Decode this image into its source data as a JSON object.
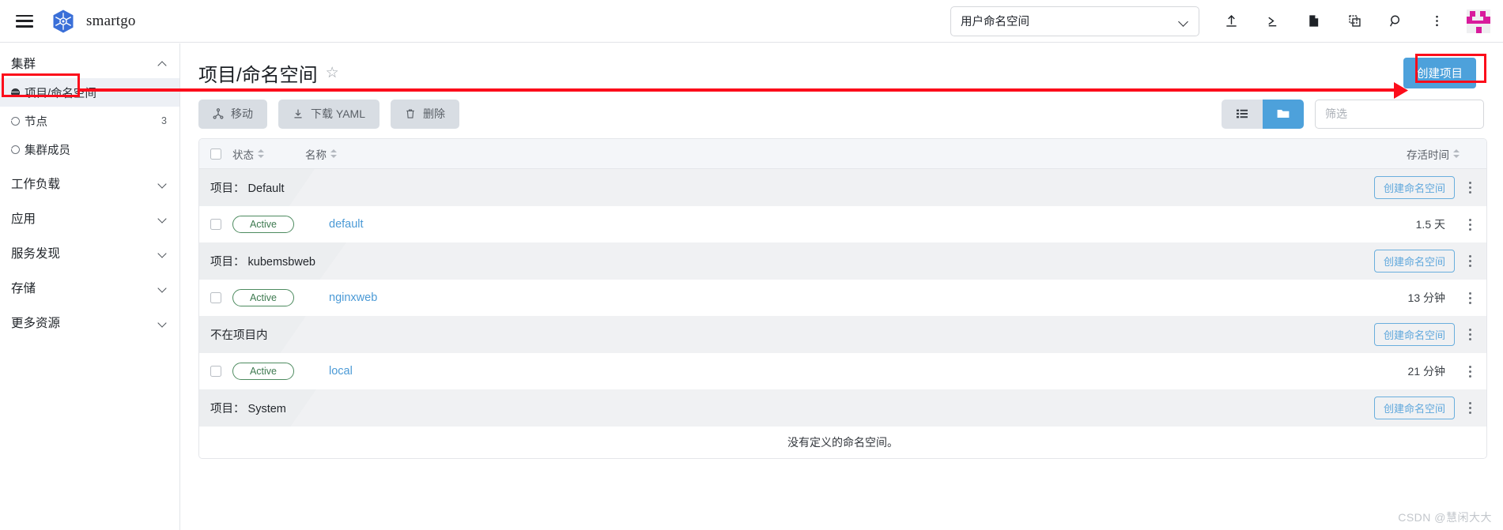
{
  "header": {
    "menu_icon": "hamburger-icon",
    "brand": "smartgo",
    "namespace_select": {
      "value": "用户命名空间",
      "chevron": "chevron-down-icon"
    },
    "icons": [
      {
        "name": "upload-icon"
      },
      {
        "name": "shell-icon"
      },
      {
        "name": "file-icon"
      },
      {
        "name": "copy-icon"
      },
      {
        "name": "search-icon"
      },
      {
        "name": "more-vertical-icon"
      }
    ],
    "avatar": "user-avatar"
  },
  "sidebar": {
    "groups": [
      {
        "label": "集群",
        "expanded": true,
        "items": [
          {
            "label": "项目/命名空间",
            "count": "",
            "active": true
          },
          {
            "label": "节点",
            "count": "3",
            "active": false
          },
          {
            "label": "集群成员",
            "count": "",
            "active": false
          }
        ]
      },
      {
        "label": "工作负载",
        "expanded": false,
        "items": []
      },
      {
        "label": "应用",
        "expanded": false,
        "items": []
      },
      {
        "label": "服务发现",
        "expanded": false,
        "items": []
      },
      {
        "label": "存储",
        "expanded": false,
        "items": []
      },
      {
        "label": "更多资源",
        "expanded": false,
        "items": []
      }
    ]
  },
  "main": {
    "page_title": "项目/命名空间",
    "favorite_icon": "star-icon",
    "create_project_button": "创建项目",
    "toolbar": {
      "move_button": "移动",
      "download_yaml_button": "下载 YAML",
      "delete_button": "删除",
      "view_list_icon": "list-view-icon",
      "view_group_icon": "group-view-icon",
      "filter_placeholder": "筛选",
      "filter_value": ""
    },
    "table": {
      "columns": {
        "state": "状态",
        "name": "名称",
        "age": "存活时间"
      },
      "create_namespace_button": "创建命名空间",
      "groups": [
        {
          "prefix": "项目：",
          "name": "Default",
          "tab_width": 146,
          "rows": [
            {
              "state": "Active",
              "name": "default",
              "age": "1.5 天"
            }
          ],
          "empty_text": ""
        },
        {
          "prefix": "项目：",
          "name": "kubemsbweb",
          "tab_width": 186,
          "rows": [
            {
              "state": "Active",
              "name": "nginxweb",
              "age": "13 分钟"
            }
          ],
          "empty_text": ""
        },
        {
          "prefix": "",
          "name": "不在项目内",
          "tab_width": 135,
          "rows": [
            {
              "state": "Active",
              "name": "local",
              "age": "21 分钟"
            }
          ],
          "empty_text": ""
        },
        {
          "prefix": "项目：",
          "name": "System",
          "tab_width": 148,
          "rows": [],
          "empty_text": "没有定义的命名空间。"
        }
      ]
    }
  },
  "watermark": "CSDN @慧闲大大",
  "colors": {
    "accent_blue": "#4da1db",
    "link_blue": "#4b9ad6",
    "annotation_red": "#fc0d1b",
    "active_green": "#3e7a50",
    "avatar_pink": "#d81b9c"
  }
}
